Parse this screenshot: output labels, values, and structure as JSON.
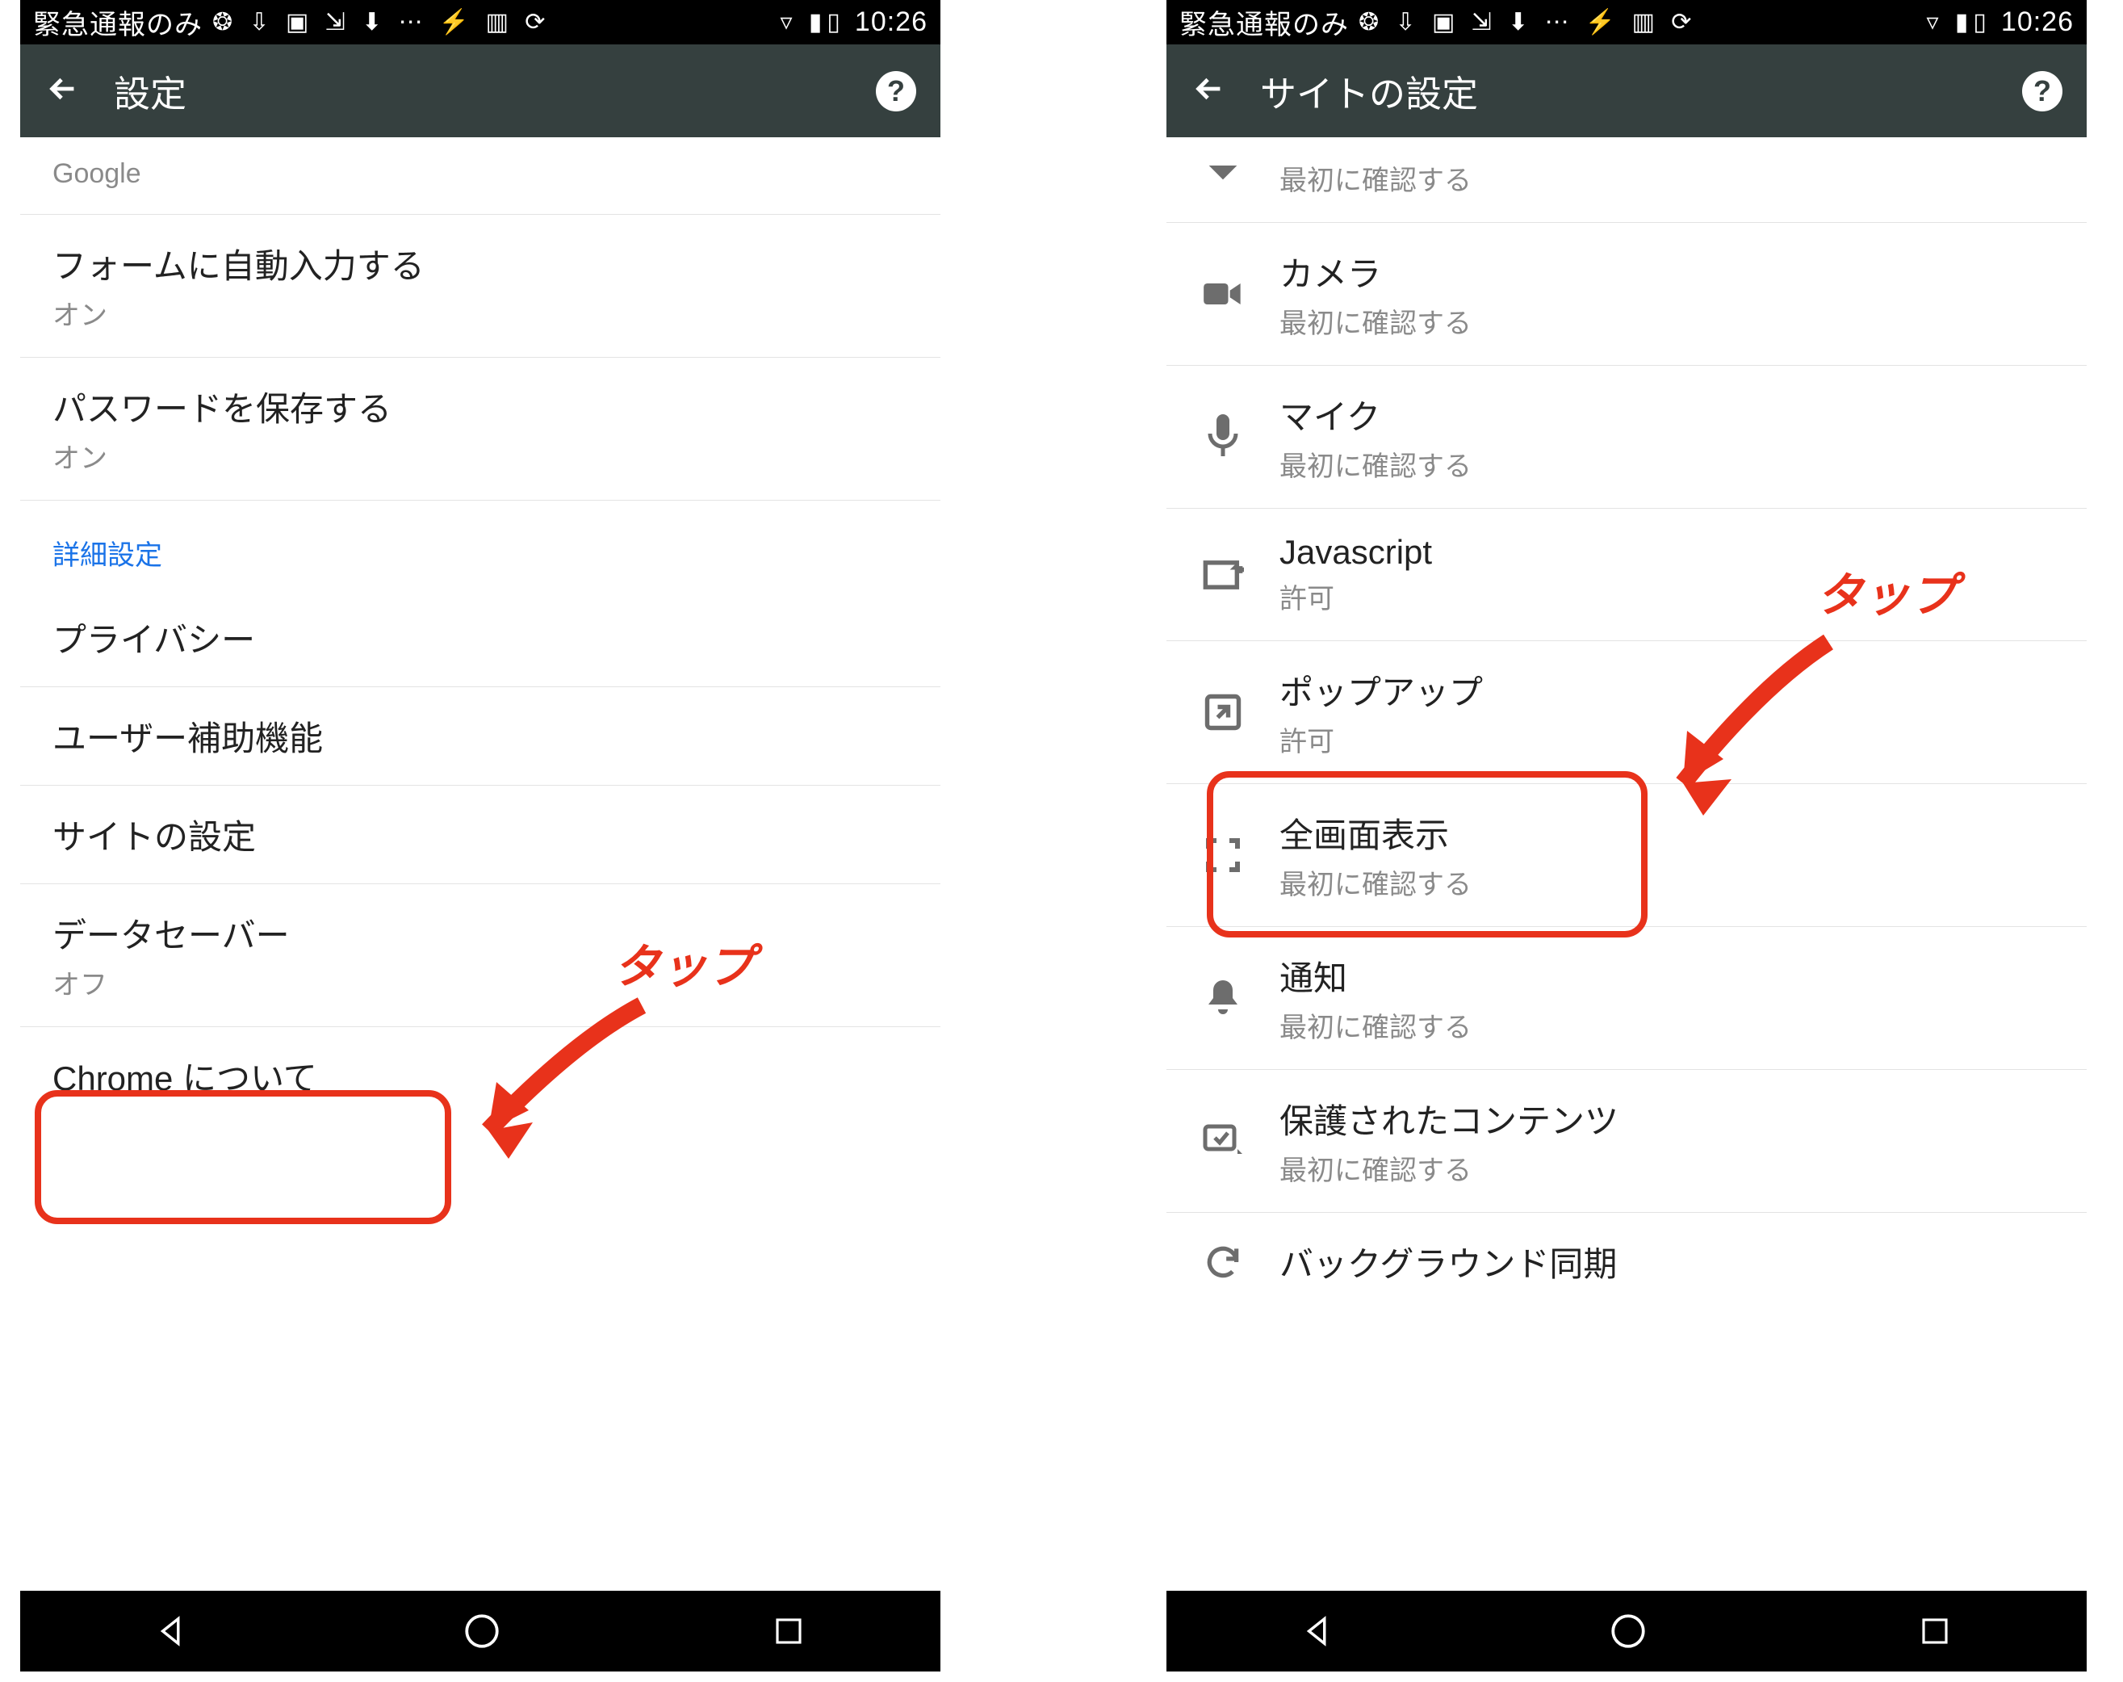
{
  "statusbar": {
    "carrier": "緊急通報のみ",
    "time": "10:26"
  },
  "left": {
    "appbar_title": "設定",
    "rows": {
      "google_sub": "Google",
      "autofill_label": "フォームに自動入力する",
      "autofill_sub": "オン",
      "password_label": "パスワードを保存する",
      "password_sub": "オン",
      "section": "詳細設定",
      "privacy_label": "プライバシー",
      "accessibility_label": "ユーザー補助機能",
      "site_settings_label": "サイトの設定",
      "data_saver_label": "データセーバー",
      "data_saver_sub": "オフ",
      "about_label": "Chrome について"
    },
    "annotation": "タップ"
  },
  "right": {
    "appbar_title": "サイトの設定",
    "rows": {
      "location_sub": "最初に確認する",
      "camera_label": "カメラ",
      "camera_sub": "最初に確認する",
      "mic_label": "マイク",
      "mic_sub": "最初に確認する",
      "js_label": "Javascript",
      "js_sub": "許可",
      "popup_label": "ポップアップ",
      "popup_sub": "許可",
      "fullscreen_label": "全画面表示",
      "fullscreen_sub": "最初に確認する",
      "notif_label": "通知",
      "notif_sub": "最初に確認する",
      "protected_label": "保護されたコンテンツ",
      "protected_sub": "最初に確認する",
      "bgsync_label": "バックグラウンド同期"
    },
    "annotation": "タップ"
  }
}
